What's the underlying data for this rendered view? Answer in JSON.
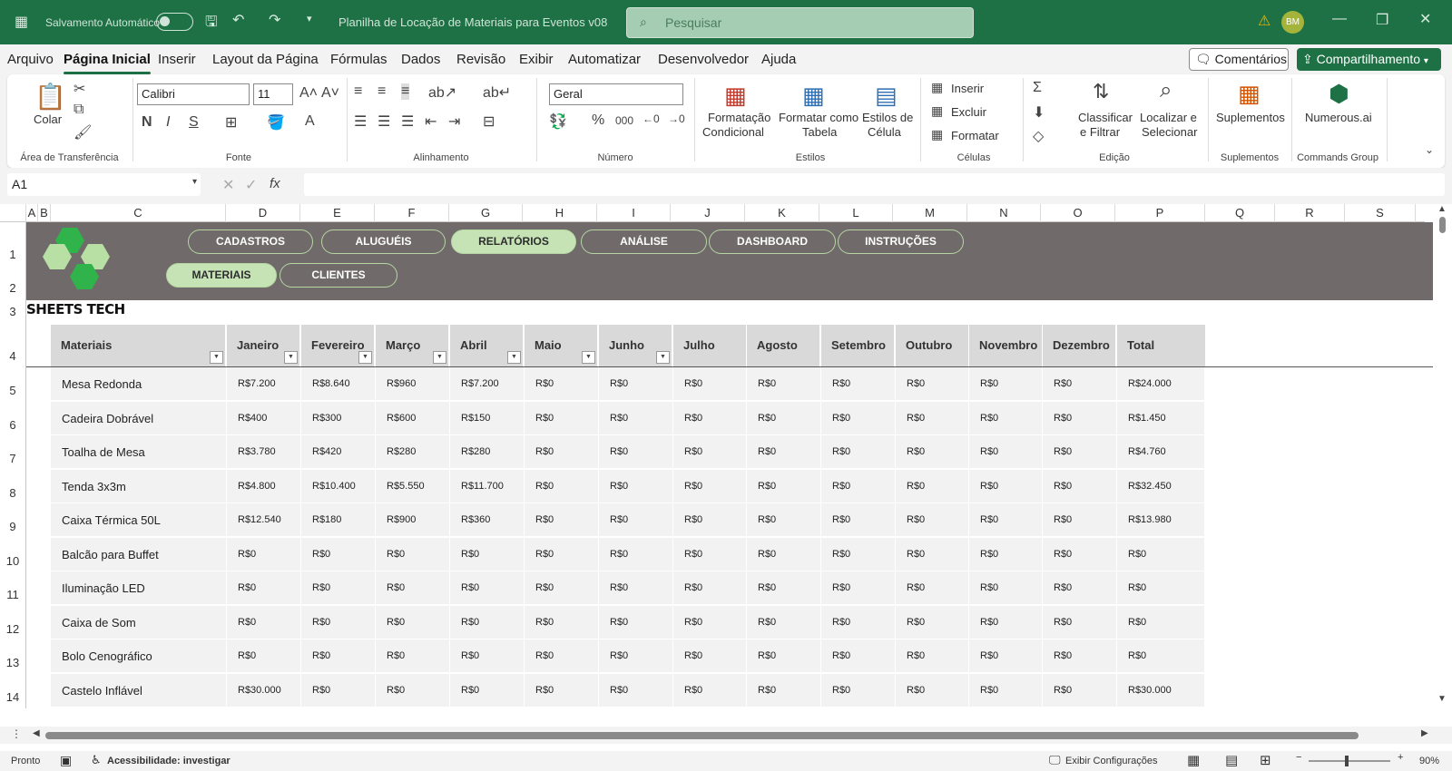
{
  "titlebar": {
    "autosave_label": "Salvamento Automático",
    "doc_title": "Planilha de Locação de Materiais para Eventos v08",
    "search_placeholder": "Pesquisar",
    "user_initials": "BM"
  },
  "menu": {
    "items": [
      "Arquivo",
      "Página Inicial",
      "Inserir",
      "Layout da Página",
      "Fórmulas",
      "Dados",
      "Revisão",
      "Exibir",
      "Automatizar",
      "Desenvolvedor",
      "Ajuda"
    ],
    "active": "Página Inicial",
    "comments_label": "Comentários",
    "share_label": "Compartilhamento"
  },
  "ribbon": {
    "paste_label": "Colar",
    "clipboard_group": "Área de Transferência",
    "font_name": "Calibri",
    "font_size": "11",
    "font_group": "Fonte",
    "alignment_group": "Alinhamento",
    "number_format": "Geral",
    "number_group": "Número",
    "cond_format_1": "Formatação",
    "cond_format_2": "Condicional",
    "format_table_1": "Formatar como",
    "format_table_2": "Tabela",
    "cell_styles_1": "Estilos de",
    "cell_styles_2": "Célula",
    "styles_group": "Estilos",
    "insert_label": "Inserir",
    "delete_label": "Excluir",
    "format_label": "Formatar",
    "cells_group": "Células",
    "sort_1": "Classificar",
    "sort_2": "e Filtrar",
    "find_1": "Localizar e",
    "find_2": "Selecionar",
    "editing_group": "Edição",
    "addins_label": "Suplementos",
    "addins_group": "Suplementos",
    "numerous_label": "Numerous.ai",
    "commands_group": "Commands Group"
  },
  "formula_bar": {
    "name_box": "A1",
    "fx": "fx"
  },
  "columns": [
    "A",
    "B",
    "C",
    "D",
    "E",
    "F",
    "G",
    "H",
    "I",
    "J",
    "K",
    "L",
    "M",
    "N",
    "O",
    "P",
    "Q",
    "R",
    "S"
  ],
  "rows": [
    "1",
    "2",
    "3",
    "4",
    "5",
    "6",
    "7",
    "8",
    "9",
    "10",
    "11",
    "12",
    "13",
    "14"
  ],
  "nav": {
    "top": [
      "CADASTROS",
      "ALUGUÉIS",
      "RELATÓRIOS",
      "ANÁLISE",
      "DASHBOARD",
      "INSTRUÇÕES"
    ],
    "top_active": "RELATÓRIOS",
    "sub": [
      "MATERIAIS",
      "CLIENTES"
    ],
    "sub_active": "MATERIAIS"
  },
  "brand": "SHEETS TECH",
  "table": {
    "headers": [
      "Materiais",
      "Janeiro",
      "Fevereiro",
      "Março",
      "Abril",
      "Maio",
      "Junho",
      "Julho",
      "Agosto",
      "Setembro",
      "Outubro",
      "Novembro",
      "Dezembro",
      "Total"
    ],
    "rows": [
      [
        "Mesa Redonda",
        "R$7.200",
        "R$8.640",
        "R$960",
        "R$7.200",
        "R$0",
        "R$0",
        "R$0",
        "R$0",
        "R$0",
        "R$0",
        "R$0",
        "R$0",
        "R$24.000"
      ],
      [
        "Cadeira Dobrável",
        "R$400",
        "R$300",
        "R$600",
        "R$150",
        "R$0",
        "R$0",
        "R$0",
        "R$0",
        "R$0",
        "R$0",
        "R$0",
        "R$0",
        "R$1.450"
      ],
      [
        "Toalha de Mesa",
        "R$3.780",
        "R$420",
        "R$280",
        "R$280",
        "R$0",
        "R$0",
        "R$0",
        "R$0",
        "R$0",
        "R$0",
        "R$0",
        "R$0",
        "R$4.760"
      ],
      [
        "Tenda 3x3m",
        "R$4.800",
        "R$10.400",
        "R$5.550",
        "R$11.700",
        "R$0",
        "R$0",
        "R$0",
        "R$0",
        "R$0",
        "R$0",
        "R$0",
        "R$0",
        "R$32.450"
      ],
      [
        "Caixa Térmica 50L",
        "R$12.540",
        "R$180",
        "R$900",
        "R$360",
        "R$0",
        "R$0",
        "R$0",
        "R$0",
        "R$0",
        "R$0",
        "R$0",
        "R$0",
        "R$13.980"
      ],
      [
        "Balcão para Buffet",
        "R$0",
        "R$0",
        "R$0",
        "R$0",
        "R$0",
        "R$0",
        "R$0",
        "R$0",
        "R$0",
        "R$0",
        "R$0",
        "R$0",
        "R$0"
      ],
      [
        "Iluminação LED",
        "R$0",
        "R$0",
        "R$0",
        "R$0",
        "R$0",
        "R$0",
        "R$0",
        "R$0",
        "R$0",
        "R$0",
        "R$0",
        "R$0",
        "R$0"
      ],
      [
        "Caixa de Som",
        "R$0",
        "R$0",
        "R$0",
        "R$0",
        "R$0",
        "R$0",
        "R$0",
        "R$0",
        "R$0",
        "R$0",
        "R$0",
        "R$0",
        "R$0"
      ],
      [
        "Bolo Cenográfico",
        "R$0",
        "R$0",
        "R$0",
        "R$0",
        "R$0",
        "R$0",
        "R$0",
        "R$0",
        "R$0",
        "R$0",
        "R$0",
        "R$0",
        "R$0"
      ],
      [
        "Castelo Inflável",
        "R$30.000",
        "R$0",
        "R$0",
        "R$0",
        "R$0",
        "R$0",
        "R$0",
        "R$0",
        "R$0",
        "R$0",
        "R$0",
        "R$0",
        "R$30.000"
      ]
    ]
  },
  "status": {
    "ready": "Pronto",
    "accessibility": "Acessibilidade: investigar",
    "display_settings": "Exibir Configurações",
    "zoom": "90%"
  },
  "colors": {
    "excel_green": "#1e7145",
    "banner_gray": "#706a6a",
    "nav_active": "#c6e3b5"
  }
}
